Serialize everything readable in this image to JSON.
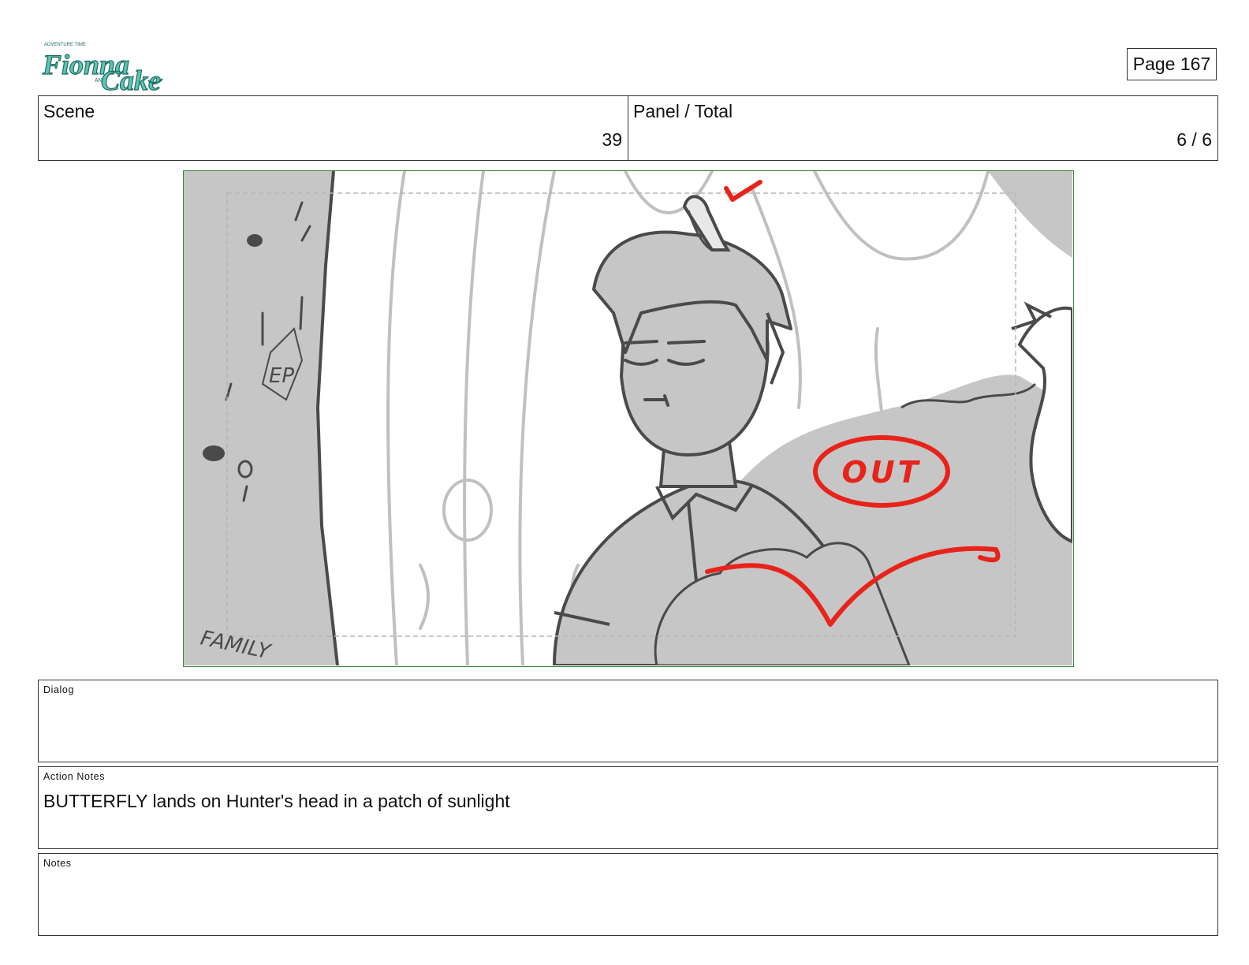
{
  "header": {
    "logo": {
      "line1": "ADVENTURE TIME",
      "word1": "Fionna",
      "connector": "AND",
      "word2": "Cake",
      "color": "#5fc4b4",
      "outline": "#1f6b62"
    },
    "page_label": "Page 167"
  },
  "scene_info": {
    "scene_label": "Scene",
    "scene_value": "39",
    "panel_label": "Panel / Total",
    "panel_value": "6 / 6"
  },
  "panel_art": {
    "annotation_text": "OUT",
    "annotation_color": "#e8231a",
    "frame_color": "#3b8a3b",
    "shadow_color": "#c6c6c6",
    "line_color": "#4a4a4a",
    "scribbles": [
      "EP",
      "FAMILY"
    ]
  },
  "fields": {
    "dialog_label": "Dialog",
    "dialog_text": "",
    "action_label": "Action Notes",
    "action_text": "BUTTERFLY lands on Hunter's head in a patch of sunlight",
    "notes_label": "Notes",
    "notes_text": ""
  }
}
